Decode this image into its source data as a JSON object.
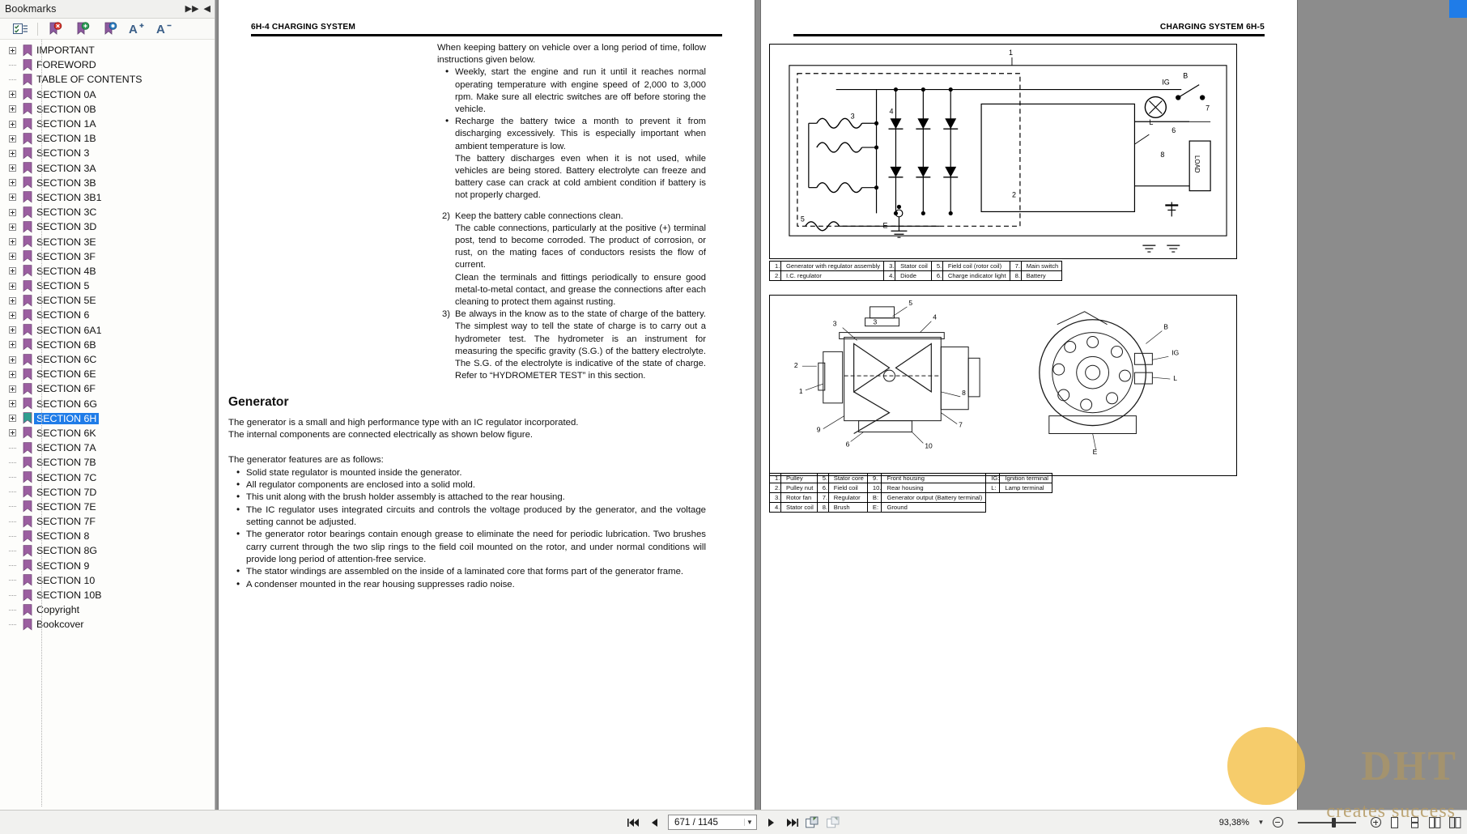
{
  "sidebar": {
    "title": "Bookmarks",
    "collapse_icon": "chevrons-right-icon",
    "close_icon": "chevron-left-icon",
    "toolbar": [
      {
        "name": "options-menu-icon",
        "glyph": "list-check-icon"
      },
      {
        "name": "delete-bookmark-icon",
        "glyph": "bookmark-delete-icon"
      },
      {
        "name": "new-bookmark-icon",
        "glyph": "bookmark-add-icon"
      },
      {
        "name": "edit-bookmark-icon",
        "glyph": "bookmark-edit-icon"
      },
      {
        "name": "increase-text-size-icon",
        "glyph": "A+"
      },
      {
        "name": "decrease-text-size-icon",
        "glyph": "A-"
      }
    ],
    "items": [
      {
        "label": "IMPORTANT",
        "expandable": true,
        "selected": false
      },
      {
        "label": "FOREWORD",
        "expandable": false,
        "selected": false
      },
      {
        "label": "TABLE OF CONTENTS",
        "expandable": false,
        "selected": false
      },
      {
        "label": "SECTION 0A",
        "expandable": true,
        "selected": false
      },
      {
        "label": "SECTION 0B",
        "expandable": true,
        "selected": false
      },
      {
        "label": "SECTION 1A",
        "expandable": true,
        "selected": false
      },
      {
        "label": "SECTION 1B",
        "expandable": true,
        "selected": false
      },
      {
        "label": "SECTION 3",
        "expandable": true,
        "selected": false
      },
      {
        "label": "SECTION 3A",
        "expandable": true,
        "selected": false
      },
      {
        "label": "SECTION 3B",
        "expandable": true,
        "selected": false
      },
      {
        "label": "SECTION 3B1",
        "expandable": true,
        "selected": false
      },
      {
        "label": "SECTION 3C",
        "expandable": true,
        "selected": false
      },
      {
        "label": "SECTION 3D",
        "expandable": true,
        "selected": false
      },
      {
        "label": "SECTION 3E",
        "expandable": true,
        "selected": false
      },
      {
        "label": "SECTION 3F",
        "expandable": true,
        "selected": false
      },
      {
        "label": "SECTION 4B",
        "expandable": true,
        "selected": false
      },
      {
        "label": "SECTION 5",
        "expandable": true,
        "selected": false
      },
      {
        "label": "SECTION 5E",
        "expandable": true,
        "selected": false
      },
      {
        "label": "SECTION 6",
        "expandable": true,
        "selected": false
      },
      {
        "label": "SECTION 6A1",
        "expandable": true,
        "selected": false
      },
      {
        "label": "SECTION 6B",
        "expandable": true,
        "selected": false
      },
      {
        "label": "SECTION 6C",
        "expandable": true,
        "selected": false
      },
      {
        "label": "SECTION 6E",
        "expandable": true,
        "selected": false
      },
      {
        "label": "SECTION 6F",
        "expandable": true,
        "selected": false
      },
      {
        "label": "SECTION 6G",
        "expandable": true,
        "selected": false
      },
      {
        "label": "SECTION 6H",
        "expandable": true,
        "selected": true
      },
      {
        "label": "SECTION 6K",
        "expandable": true,
        "selected": false
      },
      {
        "label": "SECTION 7A",
        "expandable": false,
        "selected": false
      },
      {
        "label": "SECTION 7B",
        "expandable": false,
        "selected": false
      },
      {
        "label": "SECTION 7C",
        "expandable": false,
        "selected": false
      },
      {
        "label": "SECTION 7D",
        "expandable": false,
        "selected": false
      },
      {
        "label": "SECTION 7E",
        "expandable": false,
        "selected": false
      },
      {
        "label": "SECTION 7F",
        "expandable": false,
        "selected": false
      },
      {
        "label": "SECTION 8",
        "expandable": false,
        "selected": false
      },
      {
        "label": "SECTION 8G",
        "expandable": false,
        "selected": false
      },
      {
        "label": "SECTION 9",
        "expandable": false,
        "selected": false
      },
      {
        "label": "SECTION 10",
        "expandable": false,
        "selected": false
      },
      {
        "label": "SECTION 10B",
        "expandable": false,
        "selected": false
      },
      {
        "label": "Copyright",
        "expandable": false,
        "selected": false
      },
      {
        "label": "Bookcover",
        "expandable": false,
        "selected": false
      }
    ]
  },
  "left_page": {
    "header": "6H-4 CHARGING SYSTEM",
    "intro": "When keeping battery on vehicle over a long period of time, follow instructions given below.",
    "bullets": [
      "Weekly, start the engine and run it until it reaches normal operating temperature with engine speed of 2,000 to 3,000 rpm. Make sure all electric switches are off before storing the vehicle.",
      "Recharge the battery twice a month to prevent it from discharging excessively. This is especially important when ambient temperature is low."
    ],
    "para_after_bullets": "The battery discharges even when it is not used, while vehicles are being stored. Battery electrolyte can freeze and battery case can crack at cold ambient condition if battery is not properly charged.",
    "item2_num": "2)",
    "item2_title": "Keep the battery cable connections clean.",
    "item2_body1": "The cable connections, particularly at the positive (+) terminal post, tend to become corroded. The product of corrosion, or rust, on the mating faces of conductors resists the flow of current.",
    "item2_body2": "Clean the terminals and fittings periodically to ensure good metal-to-metal contact, and grease the connections after each cleaning to protect them against rusting.",
    "item3_num": "3)",
    "item3_body": "Be always in the know as to the state of charge of the battery. The simplest way to tell the state of charge is to carry out a hydrometer test. The hydrometer is an instrument for measuring the specific gravity (S.G.) of the battery electrolyte. The S.G. of the electrolyte is indicative of the state of charge. Refer to “HYDROMETER TEST” in this section.",
    "generator_heading": "Generator",
    "generator_p1": "The generator is a small and high performance type with an IC regulator incorporated.",
    "generator_p2": "The internal components are connected electrically as shown below figure.",
    "generator_p3": "The generator features are as follows:",
    "generator_features": [
      "Solid state regulator is mounted inside the generator.",
      "All regulator components are enclosed into a solid mold.",
      "This unit along with the brush holder assembly is attached to the rear housing.",
      "The IC regulator uses integrated circuits and controls the voltage produced by the generator, and the voltage setting cannot be adjusted.",
      "The generator rotor bearings contain enough grease to eliminate the need for periodic lubrication. Two brushes carry current through the two slip rings to the field coil mounted on the rotor, and under normal conditions will provide long period of attention-free service.",
      "The stator windings are assembled on the inside of a laminated core that forms part of the generator frame.",
      "A condenser mounted in the rear housing suppresses radio noise."
    ]
  },
  "right_page": {
    "header": "CHARGING SYSTEM 6H-5",
    "figure1_name": "charging-circuit-schematic",
    "figure1_callouts": [
      "1",
      "2",
      "3",
      "4",
      "5",
      "6",
      "7",
      "8",
      "IG",
      "L",
      "E",
      "B",
      "LOAD"
    ],
    "figure1_table": [
      [
        "1.",
        "Generator with regulator assembly",
        "3.",
        "Stator coil",
        "5.",
        "Field coil (rotor coil)",
        "7.",
        "Main switch"
      ],
      [
        "2.",
        "I.C. regulator",
        "4.",
        "Diode",
        "6.",
        "Charge indicator light",
        "8.",
        "Battery"
      ]
    ],
    "figure2_name": "generator-cutaway-and-exterior",
    "figure2_callouts": [
      "1",
      "2",
      "3",
      "4",
      "5",
      "6",
      "7",
      "8",
      "9",
      "10",
      "B",
      "IG",
      "L",
      "E"
    ],
    "figure2_table": [
      [
        "1.",
        "Pulley",
        "5.",
        "Stator core",
        "9.",
        "Front housing",
        "IG:",
        "Ignition terminal"
      ],
      [
        "2.",
        "Pulley nut",
        "6.",
        "Field coil",
        "10.",
        "Rear housing",
        "L:",
        "Lamp terminal"
      ],
      [
        "3.",
        "Rotor fan",
        "7.",
        "Regulator",
        "B:",
        "Generator output (Battery terminal)",
        "",
        ""
      ],
      [
        "4.",
        "Stator coil",
        "8.",
        "Brush",
        "E:",
        "Ground",
        "",
        ""
      ]
    ]
  },
  "bottombar": {
    "first_page_icon": "first-page-icon",
    "prev_page_icon": "previous-page-icon",
    "page_value": "671 / 1145",
    "page_dropdown_icon": "chevron-down-icon",
    "next_page_icon": "next-page-icon",
    "last_page_icon": "last-page-icon",
    "prev_view_icon": "previous-view-icon",
    "next_view_icon": "next-view-icon",
    "zoom_value": "93,38%",
    "zoom_out_icon": "zoom-out-icon",
    "zoom_in_icon": "zoom-in-icon",
    "view_single_icon": "single-page-view-icon",
    "view_continuous_icon": "continuous-view-icon",
    "view_facing_icon": "facing-pages-view-icon",
    "view_cover_icon": "cover-page-view-icon"
  },
  "watermark": {
    "brand": "DHT",
    "tagline": "creates success"
  },
  "colors": {
    "selection_blue": "#1f7ce8",
    "bookmark_purple": "#9b5fa0",
    "bookmark_selected": "#2f9e8f",
    "doc_background": "#8c8c8c",
    "watermark_gold": "#b99a57"
  }
}
